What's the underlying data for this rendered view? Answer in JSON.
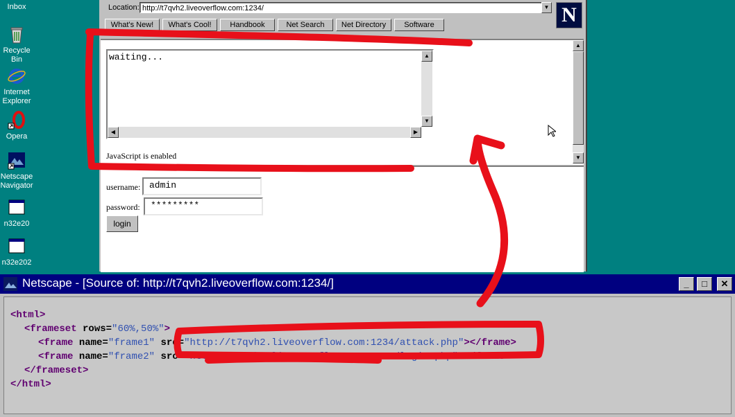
{
  "desktop": {
    "icons": [
      {
        "label": "Inbox",
        "icon": "inbox-icon"
      },
      {
        "label": "Recycle Bin",
        "icon": "recycle-bin-icon"
      },
      {
        "label": "Internet Explorer",
        "icon": "internet-explorer-icon"
      },
      {
        "label": "Opera",
        "icon": "opera-icon"
      },
      {
        "label": "Netscape Navigator",
        "icon": "netscape-navigator-icon"
      },
      {
        "label": "n32e20",
        "icon": "window-icon"
      },
      {
        "label": "n32e202",
        "icon": "window-icon"
      }
    ]
  },
  "browser": {
    "location_label": "Location:",
    "location_value": "http://t7qvh2.liveoverflow.com:1234/",
    "nav_buttons": [
      "What's New!",
      "What's Cool!",
      "Handbook",
      "Net Search",
      "Net Directory",
      "Software"
    ],
    "logo": "N",
    "frame1": {
      "textarea_value": "waiting...",
      "status_text": "JavaScript is enabled"
    },
    "frame2": {
      "username_label": "username:",
      "username_value": "admin",
      "password_label": "password:",
      "password_value": "*********",
      "login_label": "login"
    }
  },
  "source_window": {
    "title": "Netscape - [Source of: http://t7qvh2.liveoverflow.com:1234/]",
    "code": {
      "html_open": "<html>",
      "frameset_tag": "<frameset",
      "rows_attr": " rows=",
      "rows_value": "\"60%,50%\"",
      "frameset_close": ">",
      "frame1_open": "<frame",
      "frame1_name_attr": " name=",
      "frame1_name_value": "\"frame1\"",
      "frame1_src_attr": " src=",
      "frame1_src_value": "\"http://t7qvh2.liveoverflow.com:1234/attack.php\"",
      "frame1_end": "></frame>",
      "frame2_open": "<frame",
      "frame2_name_attr": " name=",
      "frame2_name_value": "\"frame2\"",
      "frame2_src_attr": " src=",
      "frame2_src_value": "\"http://t7qvh2.liveoverflow.com:1234/login.php\"",
      "frame2_end": "></frame>",
      "frameset_end": "</frameset>",
      "html_close": "</html>"
    }
  },
  "colors": {
    "desktop": "#008080",
    "titlebar": "#000080",
    "annotation": "#e8101a"
  }
}
